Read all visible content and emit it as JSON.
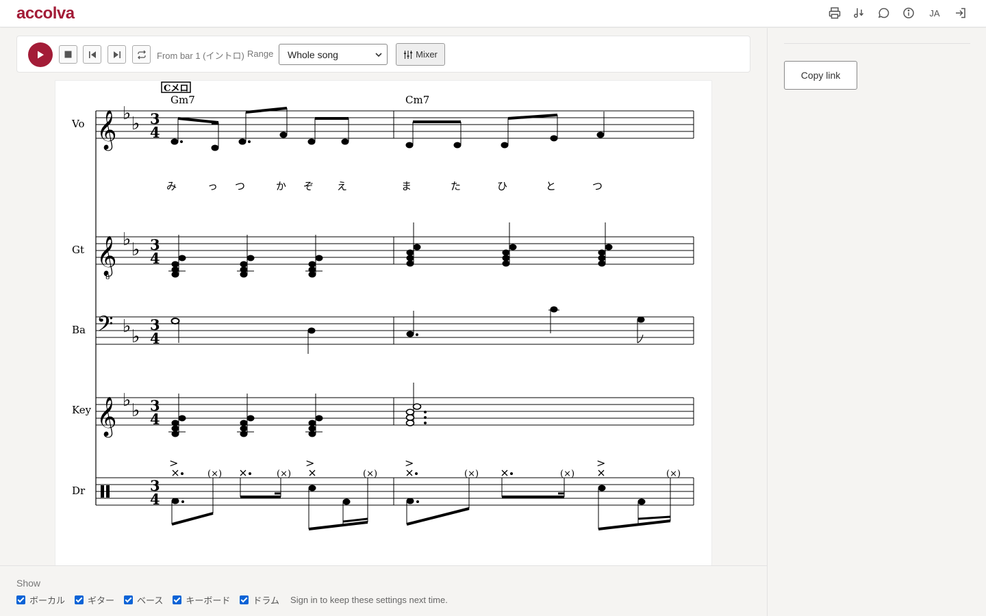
{
  "app": {
    "logo": "accolva"
  },
  "topbar": {
    "lang": "JA",
    "icons": [
      "print-icon",
      "music-note-icon",
      "comment-icon",
      "info-icon",
      "language",
      "sign-in-icon"
    ]
  },
  "player": {
    "from_text": "From bar 1 (イントロ)",
    "range_label": "Range",
    "range_value": "Whole song",
    "mixer_label": "Mixer"
  },
  "sidebar": {
    "copy_link": "Copy link"
  },
  "score": {
    "rehearsal_mark": "Cメロ",
    "chords": [
      "Gm7",
      "Cm7"
    ],
    "parts": [
      "Vo",
      "Gt",
      "Ba",
      "Key",
      "Dr"
    ],
    "lyrics": [
      "み",
      "っ",
      "つ",
      "か",
      "ぞ",
      "え",
      "ま",
      "た",
      "ひ",
      "と",
      "つ"
    ],
    "time_signature": "3/4",
    "ghost": "(×)"
  },
  "bottom": {
    "show_label": "Show",
    "checks": [
      "ボーカル",
      "ギター",
      "ベース",
      "キーボード",
      "ドラム"
    ],
    "hint": "Sign in to keep these settings next time."
  },
  "colors": {
    "brand": "#a31c37",
    "checkbox": "#0b63d6"
  }
}
